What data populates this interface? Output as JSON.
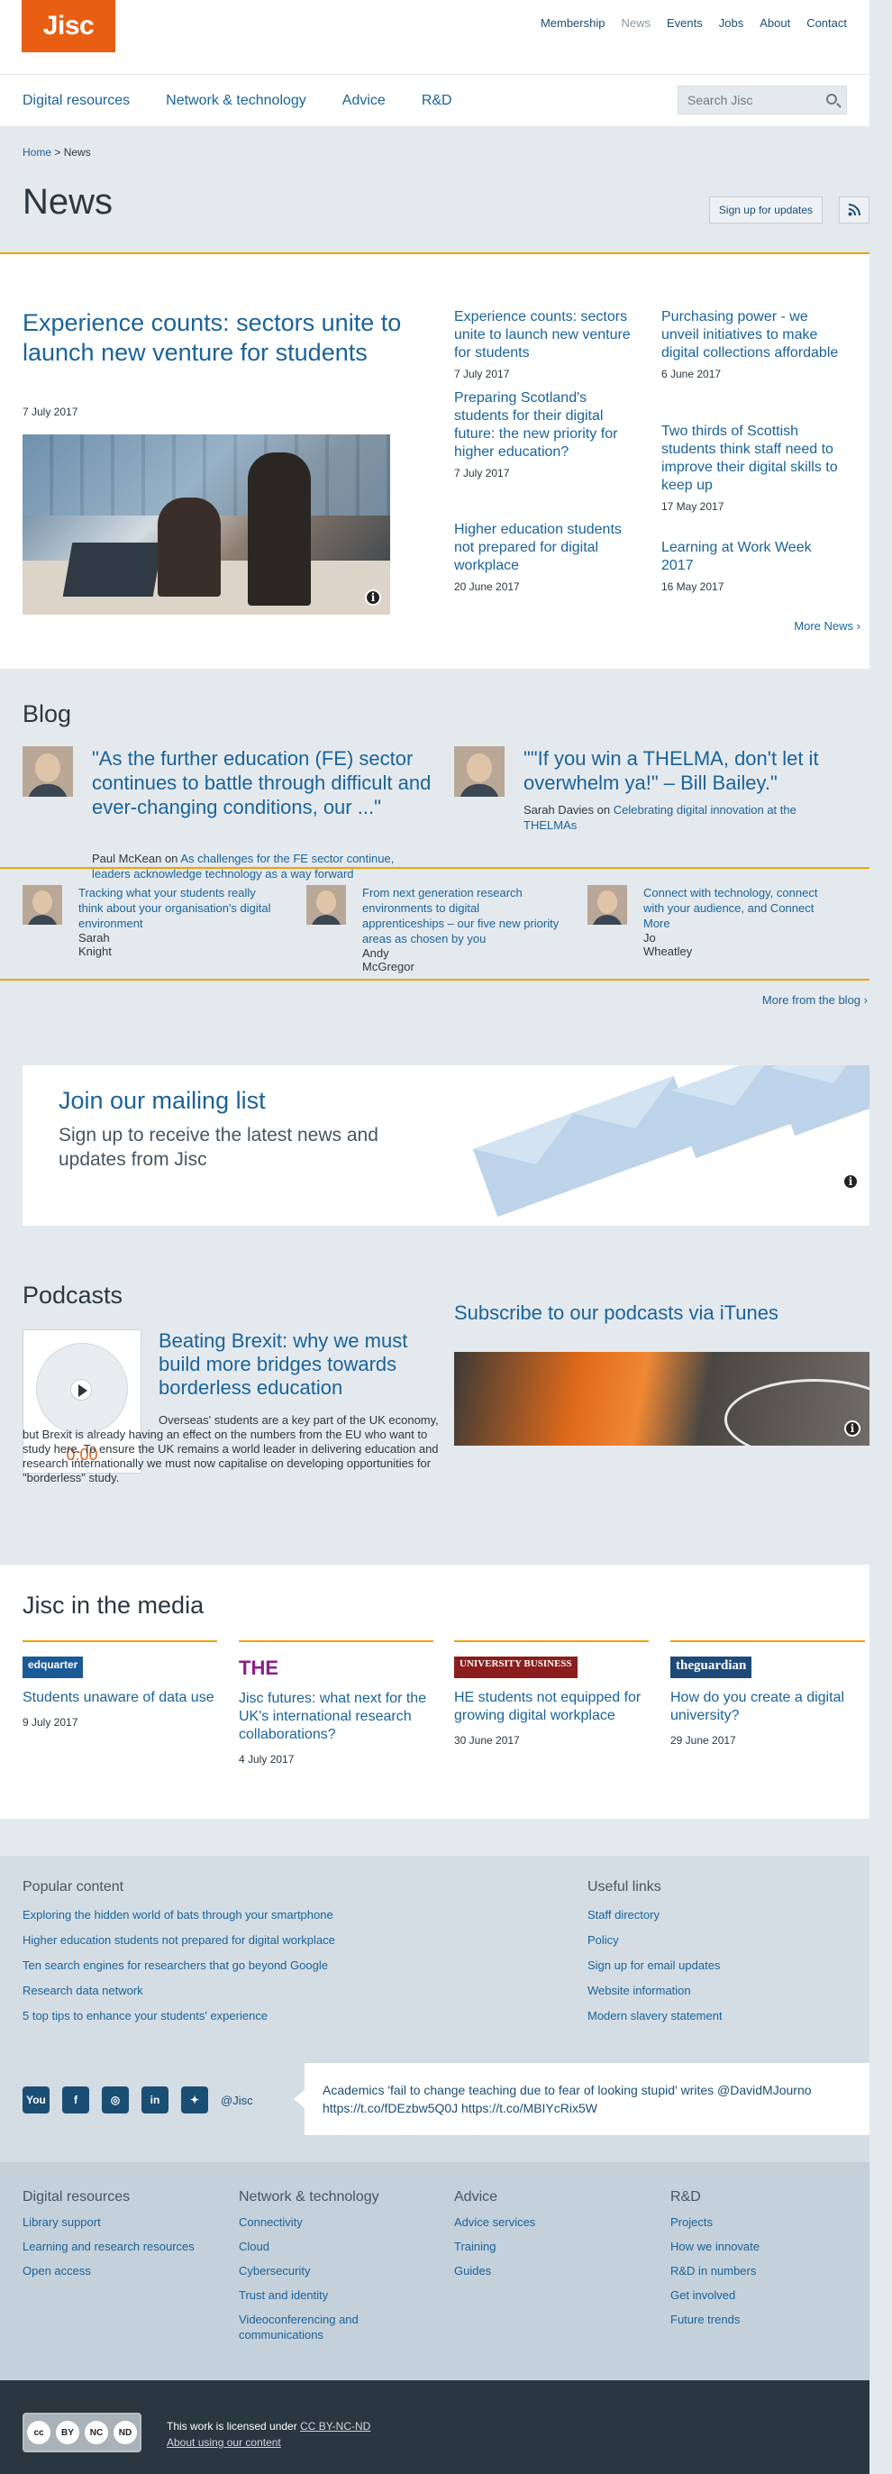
{
  "header": {
    "logo": "Jisc",
    "util_nav": [
      "Membership",
      "News",
      "Events",
      "Jobs",
      "About",
      "Contact"
    ],
    "util_nav_active": "News",
    "main_nav": [
      "Digital resources",
      "Network & technology",
      "Advice",
      "R&D"
    ],
    "search_placeholder": "Search Jisc"
  },
  "page": {
    "breadcrumb_home": "Home",
    "breadcrumb_sep": ">",
    "breadcrumb_current": "News",
    "title": "News",
    "signup_button": "Sign up for updates"
  },
  "news": {
    "featured": {
      "title": "Experience counts: sectors unite to launch new venture for students",
      "date": "7 July 2017"
    },
    "items": [
      {
        "title": "Experience counts: sectors unite to launch new venture for students",
        "date": "7 July 2017"
      },
      {
        "title": "Preparing Scotland's students for their digital future: the new priority for higher education?",
        "date": "7 July 2017"
      },
      {
        "title": "Higher education students not prepared for digital workplace",
        "date": "20 June 2017"
      },
      {
        "title": "Purchasing power - we unveil initiatives to make digital collections affordable",
        "date": "6 June 2017"
      },
      {
        "title": "Two thirds of Scottish students think staff need to improve their digital skills to keep up",
        "date": "17 May 2017"
      },
      {
        "title": "Learning at Work Week 2017",
        "date": "16 May 2017"
      }
    ],
    "more_label": "More News"
  },
  "blog": {
    "title": "Blog",
    "big_posts": [
      {
        "quote": "\"As the further education (FE) sector continues to battle through difficult and ever-changing conditions, our ...\"",
        "author": "Paul McKean",
        "on": "on",
        "post": "As challenges for the FE sector continue, leaders acknowledge technology as a way forward"
      },
      {
        "quote": "\"\"If you win a THELMA, don't let it overwhelm ya!\" – Bill Bailey.\"",
        "author": "Sarah Davies",
        "on": "on",
        "post": "Celebrating digital innovation at the THELMAs"
      }
    ],
    "small_posts": [
      {
        "title": "Tracking what your students really think about your organisation's digital environment",
        "author": "Sarah Knight"
      },
      {
        "title": "From next generation research environments to digital apprenticeships – our five new priority areas as chosen by you",
        "author": "Andy McGregor"
      },
      {
        "title": "Connect with technology, connect with your audience, and Connect More",
        "author": "Jo Wheatley"
      }
    ],
    "more_label": "More from the blog"
  },
  "mailing": {
    "title": "Join our mailing list",
    "subtitle": "Sign up to receive the latest news and updates from Jisc"
  },
  "podcasts": {
    "title": "Podcasts",
    "episode_title": "Beating Brexit: why we must build more bridges towards borderless education",
    "episode_desc": "Overseas' students are a key part of the UK economy, but Brexit is already having an effect on the numbers from the EU who want to study here. To ensure the UK remains a world leader in delivering education and research internationally we must now capitalise on developing opportunities for \"borderless\" study.",
    "player_time": "0:00",
    "subscribe_title": "Subscribe to our podcasts via iTunes"
  },
  "media": {
    "title": "Jisc in the media",
    "items": [
      {
        "logo": "edquarter",
        "title": "Students unaware of data use",
        "date": "9 July 2017"
      },
      {
        "logo": "THE",
        "title": "Jisc futures: what next for the UK's international research collaborations?",
        "date": "4 July 2017"
      },
      {
        "logo": "UNIVERSITY BUSINESS",
        "title": "HE students not equipped for growing digital workplace",
        "date": "30 June 2017"
      },
      {
        "logo": "theguardian",
        "title": "How do you create a digital university?",
        "date": "29 June 2017"
      }
    ]
  },
  "footer": {
    "popular_title": "Popular content",
    "popular": [
      "Exploring the hidden world of bats through your smartphone",
      "Higher education students not prepared for digital workplace",
      "Ten search engines for researchers that go beyond Google",
      "Research data network",
      "5 top tips to enhance your students' experience"
    ],
    "useful_title": "Useful links",
    "useful": [
      "Staff directory",
      "Policy",
      "Sign up for email updates",
      "Website information",
      "Modern slavery statement"
    ],
    "twitter_handle": "@Jisc",
    "tweet": "Academics 'fail to change teaching due to fear of looking stupid' writes @DavidMJourno https://t.co/fDEzbw5Q0J https://t.co/MBIYcRix5W",
    "columns": [
      {
        "title": "Digital resources",
        "links": [
          "Library support",
          "Learning and research resources",
          "Open access"
        ]
      },
      {
        "title": "Network & technology",
        "links": [
          "Connectivity",
          "Cloud",
          "Cybersecurity",
          "Trust and identity",
          "Videoconferencing and communications"
        ]
      },
      {
        "title": "Advice",
        "links": [
          "Advice services",
          "Training",
          "Guides"
        ]
      },
      {
        "title": "R&D",
        "links": [
          "Projects",
          "How we innovate",
          "R&D in numbers",
          "Get involved",
          "Future trends"
        ]
      }
    ],
    "license_text": "This work is licensed under",
    "license_link": "CC BY-NC-ND",
    "about_content": "About using our content",
    "cc_labels": [
      "BY",
      "NC",
      "ND"
    ]
  }
}
